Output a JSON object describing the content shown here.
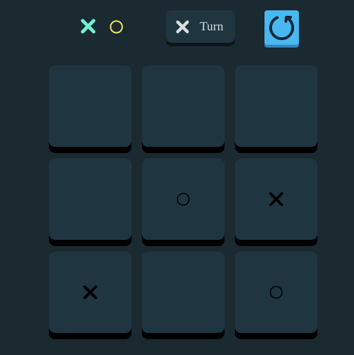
{
  "header": {
    "logo": {
      "icons": [
        "x-icon",
        "o-icon"
      ],
      "x_color": "#6ff2d4",
      "o_color": "#f2e86a"
    },
    "turn": {
      "icon": "x-icon",
      "label": "Turn"
    },
    "restart": {
      "icon": "restart-icon",
      "color": "#4ab8f0"
    }
  },
  "board": {
    "cells": [
      "",
      "",
      "",
      "",
      "O",
      "X",
      "X",
      "",
      "O"
    ],
    "mark_color": "#000000"
  }
}
